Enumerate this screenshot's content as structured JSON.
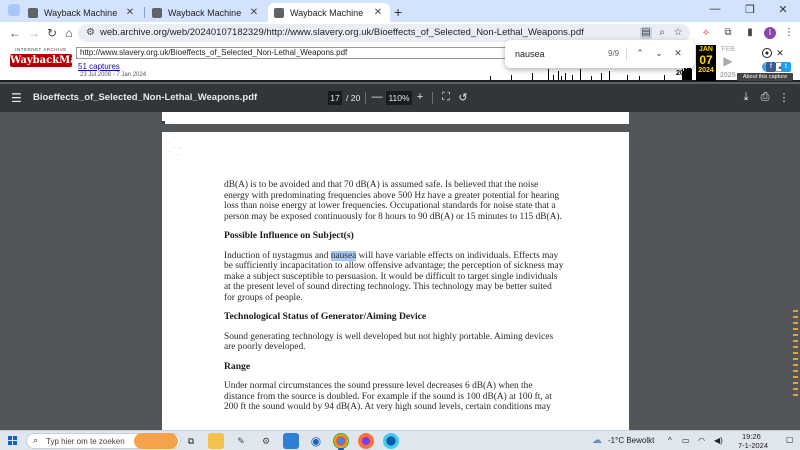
{
  "browser": {
    "tabs": [
      {
        "label": "Wayback Machine",
        "close": "✕"
      },
      {
        "label": "Wayback Machine",
        "close": "✕"
      },
      {
        "label": "Wayback Machine",
        "close": "✕"
      }
    ],
    "new_tab": "+",
    "window_controls": [
      "—",
      "❐",
      "✕"
    ],
    "url": "web.archive.org/web/20240107182329/http://www.slavery.org.uk/Bioeffects_of_Selected_Non-Lethal_Weapons.pdf",
    "profile_initial": "I"
  },
  "wayback": {
    "logo_small": "INTERNET ARCHIVE",
    "logo_big": "WaybackMachine",
    "url_input": "http://www.slavery.org.uk/Bioeffects_of_Selected_Non-Lethal_Weapons.pdf",
    "captures": "51 captures",
    "range": "23 Jul 2008 - 7 Jan 2024",
    "year_prev": "2022",
    "year_next": "2025",
    "month_prev": "",
    "month_current": "JAN",
    "day_current": "07",
    "year_current": "2024",
    "month_next": "FEB",
    "about": "About this capture",
    "histogram": [
      0,
      0,
      0,
      0,
      0,
      0,
      0,
      0,
      0,
      0,
      0,
      0,
      0,
      0,
      0,
      0,
      0,
      0,
      0,
      0,
      2,
      0,
      0,
      0,
      0,
      0,
      0,
      0,
      0,
      0,
      0,
      0,
      0,
      0,
      0,
      0,
      0,
      0,
      0,
      0,
      0,
      0,
      3,
      0,
      0,
      0,
      0,
      0,
      0,
      0,
      0,
      0,
      0,
      0,
      0,
      0,
      0,
      0,
      0,
      0,
      0,
      0,
      0,
      0,
      4,
      0,
      0,
      0,
      0,
      0,
      0,
      0,
      0,
      0,
      0,
      0,
      0,
      0,
      0,
      0,
      6,
      0,
      0,
      0,
      0,
      3,
      0,
      0,
      0,
      0,
      5,
      0,
      0,
      2,
      0,
      0,
      0,
      0,
      4,
      0,
      0,
      0,
      0,
      0,
      0,
      3,
      0,
      0,
      0,
      0,
      0,
      0,
      0,
      6,
      0,
      0,
      0,
      0,
      0,
      0,
      0,
      0,
      0,
      0,
      2,
      0,
      0,
      0,
      0,
      0,
      0,
      0,
      0,
      0,
      4,
      0,
      0,
      0,
      0,
      0,
      0,
      0,
      0,
      5,
      0,
      0,
      0,
      0,
      0,
      0,
      0,
      0,
      0,
      0,
      0,
      0,
      0,
      0,
      0,
      0,
      0,
      3,
      0,
      0,
      0,
      0,
      0,
      0,
      0,
      0,
      0,
      0,
      0,
      0,
      2,
      0,
      0,
      0,
      0,
      0,
      0,
      0,
      0,
      0,
      0,
      0,
      0,
      0,
      0,
      0,
      0,
      0,
      0,
      0,
      0,
      0,
      0,
      0,
      0,
      3,
      0,
      0,
      0,
      0,
      0,
      0,
      0,
      0,
      0,
      0,
      0,
      0,
      0,
      0,
      0,
      0,
      0,
      0,
      6,
      5,
      7,
      8,
      6,
      7,
      9,
      8,
      7,
      6
    ]
  },
  "find": {
    "query": "nausea",
    "count": "9/9",
    "prev": "⌃",
    "next": "⌄",
    "close": "✕"
  },
  "pdf": {
    "menu": "☰",
    "title": "Bioeffects_of_Selected_Non-Lethal_Weapons.pdf",
    "page": "17",
    "total": "/ 20",
    "zoom_out": "—",
    "zoom": "110%",
    "zoom_in": "+",
    "download": "⤓",
    "print": "⎙",
    "more": "⋮"
  },
  "doc": {
    "p1": "dB(A) is to be avoided and that 70 dB(A) is assumed safe. Is believed that the noise energy with predominating frequencies above 500 Hz have a greater potential for hearing loss than noise energy at lower frequencies. Occupational standards for noise state that a person may be exposed continuously for 8 hours to 90 dB(A) or 15 minutes to 115 dB(A).",
    "h1": "Possible Influence on Subject(s)",
    "p2_before": "Induction of nystagmus and ",
    "p2_highlight": "nausea",
    "p2_after": " will have variable effects on individuals. Effects may be sufficiently incapacitation to allow offensive advantage; the perception of sickness may make a subject susceptible to persuasion. It would be difficult to target single individuals at the present level of sound directing technology. This technology may be better suited for groups of people.",
    "h2": "Technological Status of Generator/Aiming Device",
    "p3": "Sound generating technology is well developed but not highly portable. Aiming devices are poorly developed.",
    "h3": "Range",
    "p4": "Under normal circumstances the sound pressure level decreases 6 dB(A) when the distance from the source is doubled. For example if the sound is 100 dB(A) at 100 ft, at 200 ft the sound would by 94 dB(A). At very high sound levels, certain conditions may"
  },
  "taskbar": {
    "search_placeholder": "Typ hier om te zoeken",
    "weather": "-1°C  Bewolkt",
    "time": "19:26",
    "date": "7-1-2024"
  },
  "colors": {
    "accent": "#0a64c8",
    "highlight": "#a8c7fa",
    "wayback_red": "#b40000",
    "pdf_toolbar": "#323639"
  }
}
